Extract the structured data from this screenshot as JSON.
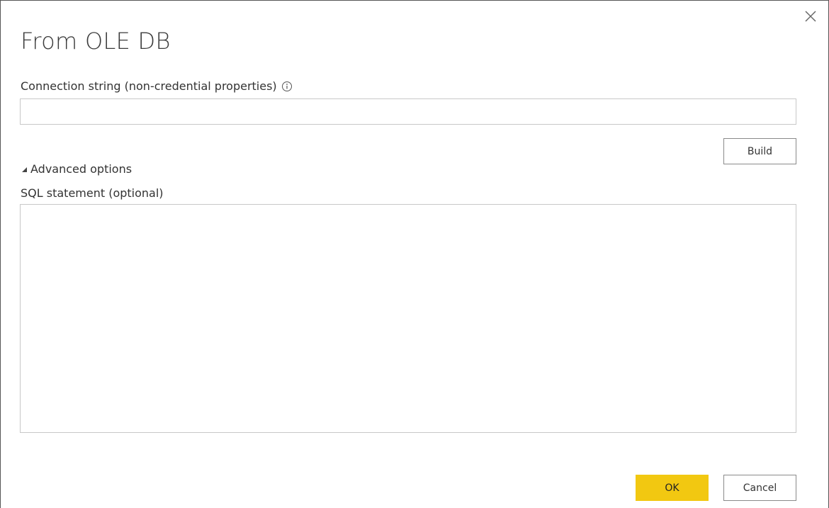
{
  "dialog": {
    "title": "From OLE DB",
    "close_icon": "close-icon"
  },
  "connection": {
    "label": "Connection string (non-credential properties)",
    "info_icon": "info-icon",
    "value": "",
    "placeholder": ""
  },
  "build_button": {
    "label": "Build"
  },
  "advanced": {
    "label": "Advanced options",
    "expanded": true,
    "toggle_icon": "triangle-expanded-icon"
  },
  "sql": {
    "label": "SQL statement (optional)",
    "value": "",
    "placeholder": ""
  },
  "footer": {
    "ok_label": "OK",
    "cancel_label": "Cancel"
  },
  "colors": {
    "ok_button": "#f2c811",
    "border": "#c8c8c8",
    "text": "#333333"
  }
}
